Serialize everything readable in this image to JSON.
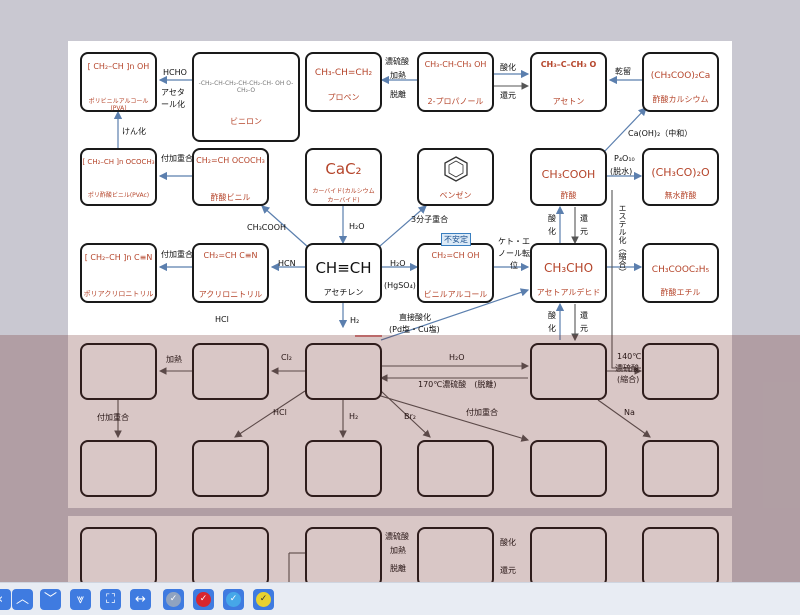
{
  "nodes": {
    "pva": {
      "formula": "[ CH₂–CH ]n  OH",
      "name": "ポリビニルアルコール(PVA)"
    },
    "vinylon": {
      "formula": "-CH₂-CH-CH₂-CH-CH₂-CH-  OH  O-CH₂-O",
      "name": "ビニロン"
    },
    "propene": {
      "formula": "CH₃-CH=CH₂",
      "name": "プロペン"
    },
    "propanol": {
      "formula": "CH₃-CH-CH₃  OH",
      "name": "2-プロパノール"
    },
    "acetone": {
      "formula": "CH₃–C–CH₃  O",
      "name": "アセトン"
    },
    "calcium_acetate": {
      "formula": "(CH₃COO)₂Ca",
      "name": "酢酸カルシウム"
    },
    "pvac": {
      "formula": "[ CH₂–CH ]n  OCOCH₃",
      "name": "ポリ酢酸ビニル(PVAc)"
    },
    "vinyl_acetate": {
      "formula": "CH₂=CH  OCOCH₃",
      "name": "酢酸ビニル"
    },
    "carbide": {
      "formula": "CaC₂",
      "name": "カーバイド(カルシウムカーバイド)"
    },
    "benzene": {
      "formula": "",
      "name": "ベンゼン"
    },
    "acetic_acid": {
      "formula": "CH₃COOH",
      "name": "酢酸"
    },
    "anhydride": {
      "formula": "(CH₃CO)₂O",
      "name": "無水酢酸"
    },
    "pan": {
      "formula": "[ CH₂–CH ]n  C≡N",
      "name": "ポリアクリロニトリル"
    },
    "acrylonitrile": {
      "formula": "CH₂=CH  C≡N",
      "name": "アクリロニトリル"
    },
    "acetylene": {
      "formula": "CH≡CH",
      "name": "アセチレン"
    },
    "vinyl_alcohol": {
      "formula": "CH₂=CH  OH",
      "name": "ビニルアルコール"
    },
    "acetaldehyde": {
      "formula": "CH₃CHO",
      "name": "アセトアルデヒド"
    },
    "ethyl_acetate": {
      "formula": "CH₃COOC₂H₅",
      "name": "酢酸エチル"
    }
  },
  "labels": {
    "hcho": "HCHO",
    "acetalization": "アセタール化",
    "conc_sulfuric": "濃硫酸",
    "heat": "加熱",
    "dehydration": "脱離",
    "oxidation": "酸化",
    "reduction": "還元",
    "dry_distillation": "乾留",
    "saponification": "けん化",
    "addition_polymerization": "付加重合",
    "caoh2": "Ca(OH)₂（中和）",
    "p4o10": "P₄O₁₀",
    "dehydrate_paren": "(脱水)",
    "ch3cooh": "CH₃COOH",
    "h2o": "H₂O",
    "trimerization": "3分子重合",
    "unstable": "不安定",
    "esterification": "エステル化（縮合）",
    "ox_a": "酸化",
    "red_a": "還元",
    "hcn": "HCN",
    "keto_enol": "ケト・エノール転位",
    "hgso4": "(HgSO₄)",
    "hcl": "HCl",
    "h2": "H₂",
    "direct_oxidation": "直接酸化",
    "catalyst": "(Pd塩・Cu塩)",
    "ox_b": "酸化",
    "red_b": "還元",
    "heat2": "加熱",
    "cl2": "Cl₂",
    "h2o_2": "H₂O",
    "temp140": "140℃",
    "conc_sulfuric2": "濃硫酸",
    "condensation": "(縮合)",
    "temp170": "170℃濃硫酸　(脱離)",
    "addition_polymerization2": "付加重合",
    "hcl2": "HCl",
    "h2_2": "H₂",
    "br2": "Br₂",
    "addition_polymerization3": "付加重合",
    "na": "Na",
    "conc_sulfuric3": "濃硫酸",
    "heat3": "加熱",
    "dehydration3": "脱離",
    "oxidation3": "酸化",
    "reduction3": "還元"
  },
  "toolbar": {
    "buttons": [
      "chevron-up-icon",
      "chevron-down-icon",
      "double-chevron-down-icon",
      "fit-screen-icon",
      "fit-width-icon"
    ],
    "check_colors": [
      "#8fa3c0",
      "#d8262e",
      "#46a7e8",
      "#e8d230"
    ]
  }
}
